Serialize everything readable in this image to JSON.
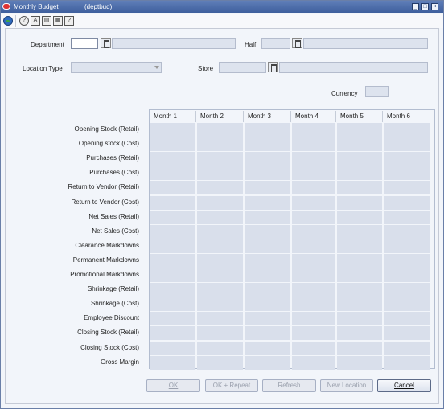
{
  "window": {
    "title": "Monthly Budget",
    "subtitle": "(deptbud)",
    "controls": [
      "_",
      "□",
      "×"
    ]
  },
  "toolbar": {
    "icons": [
      "globe-icon",
      "help-icon",
      "find-icon",
      "save-icon",
      "print-icon",
      "question-icon"
    ],
    "glyphs": [
      "?",
      "A",
      "▤",
      "▦",
      "?"
    ]
  },
  "header": {
    "department_label": "Department",
    "department_value": "",
    "half_label": "Half",
    "half_value": "",
    "location_type_label": "Location Type",
    "location_type_value": "",
    "store_label": "Store",
    "store_value": "",
    "currency_label": "Currency",
    "currency_value": ""
  },
  "grid": {
    "columns": [
      "Month 1",
      "Month 2",
      "Month 3",
      "Month 4",
      "Month 5",
      "Month 6"
    ],
    "rows": [
      "Opening Stock (Retail)",
      "Opening stock (Cost)",
      "Purchases (Retail)",
      "Purchases (Cost)",
      "Return to Vendor (Retail)",
      "Return to Vendor (Cost)",
      "Net Sales (Retail)",
      "Net Sales (Cost)",
      "Clearance Markdowns",
      "Permanent Markdowns",
      "Promotional Markdowns",
      "Shrinkage (Retail)",
      "Shrinkage (Cost)",
      "Employee Discount",
      "Closing Stock (Retail)",
      "Closing Stock (Cost)",
      "Gross Margin"
    ]
  },
  "buttons": {
    "ok": "OK",
    "ok_repeat": "OK + Repeat",
    "refresh": "Refresh",
    "new_location": "New Location",
    "cancel": "Cancel"
  },
  "colors": {
    "titlebar": "#4a6aa8",
    "field_fill": "#dde3ee",
    "grid_cell": "#d9dfeb",
    "background": "#f2f5fa"
  }
}
